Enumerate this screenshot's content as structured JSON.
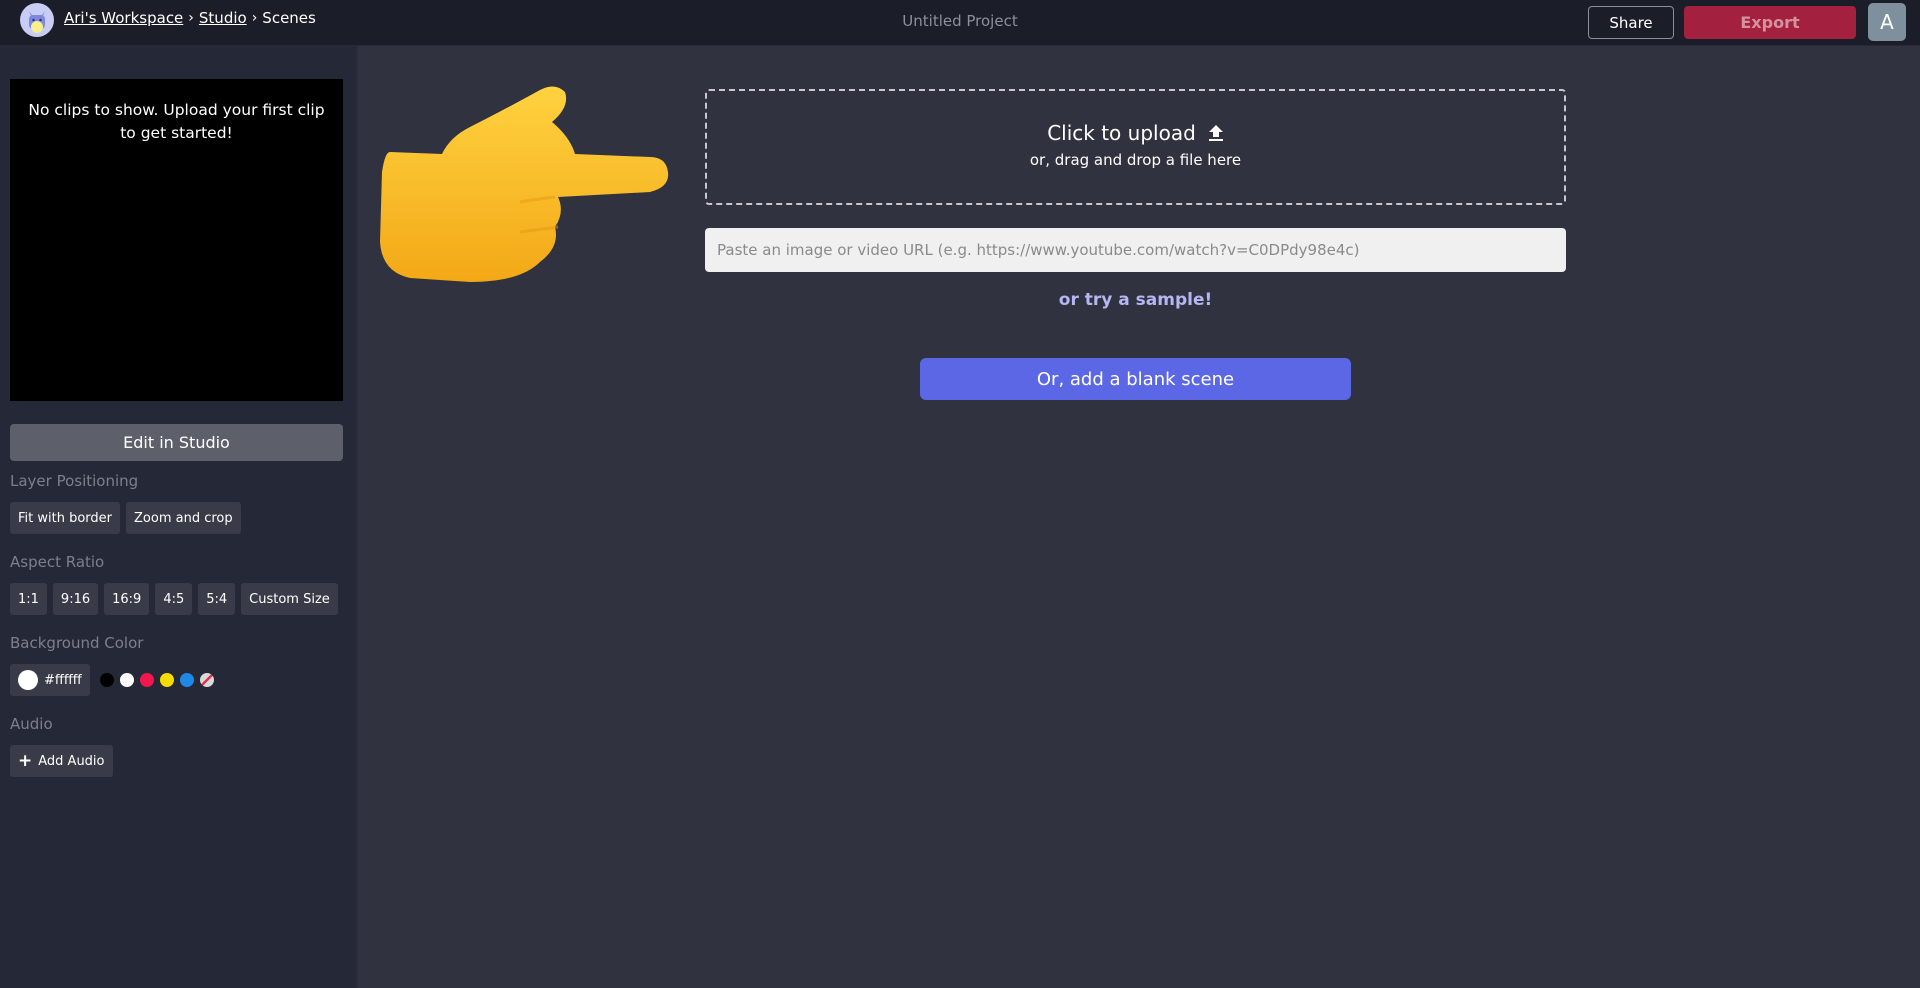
{
  "header": {
    "breadcrumb": [
      {
        "label": "Ari's Workspace",
        "link": true
      },
      {
        "label": "Studio",
        "link": true
      },
      {
        "label": "Scenes",
        "link": false
      }
    ],
    "separator": "›",
    "project_title": "Untitled Project",
    "share_label": "Share",
    "export_label": "Export",
    "user_initial": "A",
    "colors": {
      "export": "#a3213f",
      "avatar": "#7e8f9e"
    }
  },
  "sidebar": {
    "empty_message": "No clips to show. Upload your first clip to get started!",
    "edit_studio_label": "Edit in Studio",
    "layer_positioning": {
      "label": "Layer Positioning",
      "options": [
        "Fit with border",
        "Zoom and crop"
      ]
    },
    "aspect_ratio": {
      "label": "Aspect Ratio",
      "options": [
        "1:1",
        "9:16",
        "16:9",
        "4:5",
        "5:4",
        "Custom Size"
      ]
    },
    "background_color": {
      "label": "Background Color",
      "current": "#ffffff",
      "swatches": [
        {
          "name": "black",
          "color": "#000000"
        },
        {
          "name": "white",
          "color": "#ffffff"
        },
        {
          "name": "red",
          "color": "#f2184f"
        },
        {
          "name": "yellow",
          "color": "#f8dc00"
        },
        {
          "name": "blue",
          "color": "#1f8ae6"
        },
        {
          "name": "transparent",
          "color": "none"
        }
      ]
    },
    "audio": {
      "label": "Audio",
      "add_label": "Add Audio",
      "icon": "plus-icon"
    }
  },
  "main": {
    "pointer_icon": "pointing-right-hand-icon",
    "upload": {
      "title": "Click to upload",
      "icon": "upload-icon",
      "subtitle": "or, drag and drop a file here"
    },
    "url_input": {
      "value": "",
      "placeholder": "Paste an image or video URL (e.g. https://www.youtube.com/watch?v=C0DPdy98e4c)"
    },
    "sample_link": "or try a sample!",
    "blank_scene_label": "Or, add a blank scene",
    "colors": {
      "accent": "#5b67e4",
      "sample_link": "#b5b6f2"
    }
  }
}
